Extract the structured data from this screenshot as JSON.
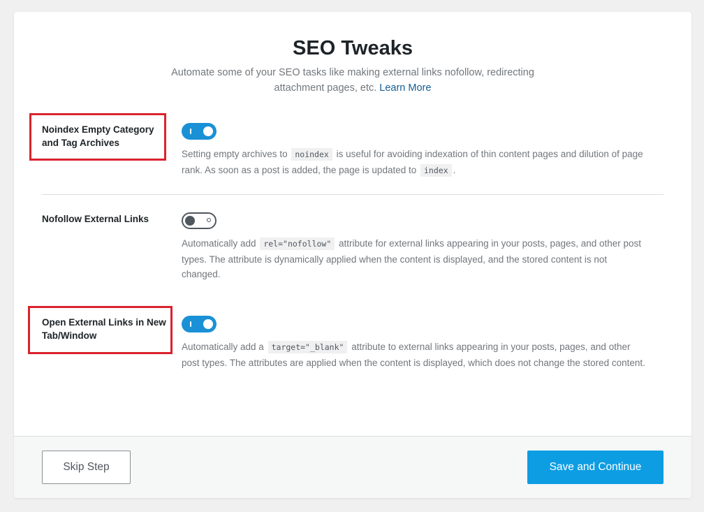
{
  "header": {
    "title": "SEO Tweaks",
    "subtitle": "Automate some of your SEO tasks like making external links nofollow, redirecting attachment pages, etc.",
    "learn_more": "Learn More"
  },
  "settings": [
    {
      "label": "Noindex Empty Category and Tag Archives",
      "enabled": true,
      "desc_parts": [
        "Setting empty archives to",
        "noindex",
        "is useful for avoiding indexation of thin content pages and dilution of page rank. As soon as a post is added, the page is updated to",
        "index",
        "."
      ]
    },
    {
      "label": "Nofollow External Links",
      "enabled": false,
      "desc_parts": [
        "Automatically add",
        "rel=\"nofollow\"",
        "attribute for external links appearing in your posts, pages, and other post types. The attribute is dynamically applied when the content is displayed, and the stored content is not changed."
      ]
    },
    {
      "label": "Open External Links in New Tab/Window",
      "enabled": true,
      "desc_parts": [
        "Automatically add a",
        "target=\"_blank\"",
        "attribute to external links appearing in your posts, pages, and other post types. The attributes are applied when the content is displayed, which does not change the stored content."
      ]
    }
  ],
  "footer": {
    "skip_label": "Skip Step",
    "save_label": "Save and Continue"
  },
  "colors": {
    "accent": "#0d9de3",
    "toggle_on": "#1a91d6",
    "highlight": "#d9232d",
    "link": "#135e96"
  },
  "icons": {
    "toggle_on": "toggle-on-icon",
    "toggle_off": "toggle-off-icon"
  }
}
